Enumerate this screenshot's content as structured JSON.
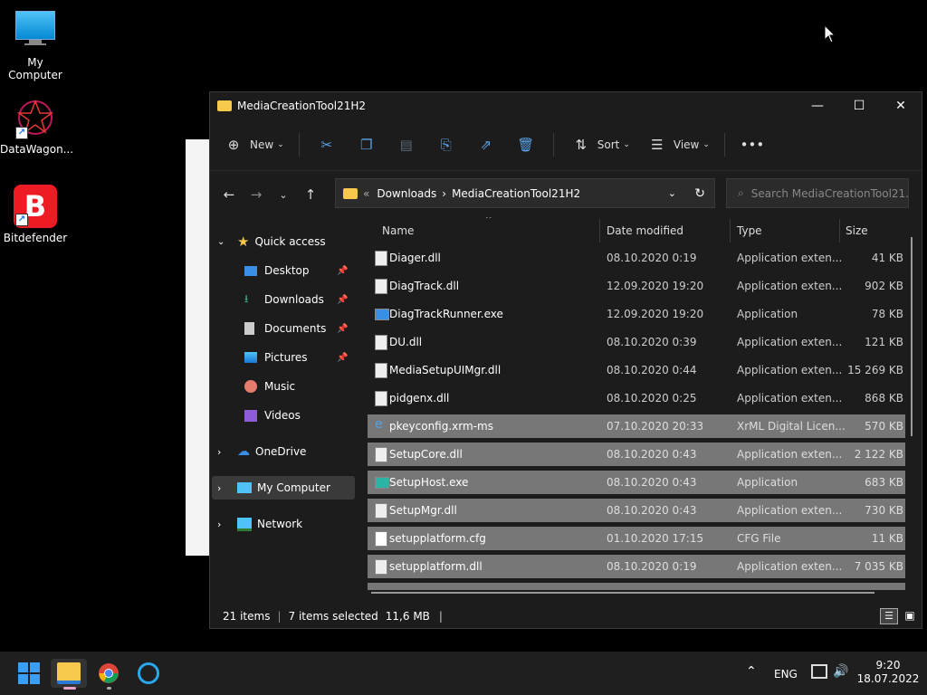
{
  "desktop": {
    "icons": [
      {
        "label": "My Computer"
      },
      {
        "label": "DataWagon..."
      },
      {
        "label": "Bitdefender"
      }
    ]
  },
  "window": {
    "title": "MediaCreationTool21H2",
    "toolbar": {
      "new_label": "New",
      "sort_label": "Sort",
      "view_label": "View"
    },
    "address": {
      "overflow": "«",
      "crumbs": [
        "Downloads",
        "MediaCreationTool21H2"
      ],
      "separator": "›"
    },
    "search_placeholder": "Search MediaCreationTool21...",
    "nav": {
      "quick_access": "Quick access",
      "items": [
        "Desktop",
        "Downloads",
        "Documents",
        "Pictures",
        "Music",
        "Videos"
      ],
      "onedrive": "OneDrive",
      "my_computer": "My Computer",
      "network": "Network"
    },
    "columns": {
      "name": "Name",
      "date": "Date modified",
      "type": "Type",
      "size": "Size"
    },
    "files": [
      {
        "name": "Diager.dll",
        "date": "08.10.2020 0:19",
        "type": "Application exten...",
        "size": "41 KB"
      },
      {
        "name": "DiagTrack.dll",
        "date": "12.09.2020 19:20",
        "type": "Application exten...",
        "size": "902 KB"
      },
      {
        "name": "DiagTrackRunner.exe",
        "date": "12.09.2020 19:20",
        "type": "Application",
        "size": "78 KB"
      },
      {
        "name": "DU.dll",
        "date": "08.10.2020 0:39",
        "type": "Application exten...",
        "size": "121 KB"
      },
      {
        "name": "MediaSetupUIMgr.dll",
        "date": "08.10.2020 0:44",
        "type": "Application exten...",
        "size": "15 269 KB"
      },
      {
        "name": "pidgenx.dll",
        "date": "08.10.2020 0:25",
        "type": "Application exten...",
        "size": "868 KB"
      },
      {
        "name": "pkeyconfig.xrm-ms",
        "date": "07.10.2020 20:33",
        "type": "XrML Digital Licen...",
        "size": "570 KB"
      },
      {
        "name": "SetupCore.dll",
        "date": "08.10.2020 0:43",
        "type": "Application exten...",
        "size": "2 122 KB"
      },
      {
        "name": "SetupHost.exe",
        "date": "08.10.2020 0:43",
        "type": "Application",
        "size": "683 KB"
      },
      {
        "name": "SetupMgr.dll",
        "date": "08.10.2020 0:43",
        "type": "Application exten...",
        "size": "730 KB"
      },
      {
        "name": "setupplatform.cfg",
        "date": "01.10.2020 17:15",
        "type": "CFG File",
        "size": "11 KB"
      },
      {
        "name": "setupplatform.dll",
        "date": "08.10.2020 0:19",
        "type": "Application exten...",
        "size": "7 035 KB"
      }
    ],
    "status": {
      "count": "21 items",
      "selected": "7 items selected",
      "size": "11,6 MB"
    }
  },
  "taskbar": {
    "lang": "ENG",
    "time": "9:20",
    "date": "18.07.2022"
  }
}
